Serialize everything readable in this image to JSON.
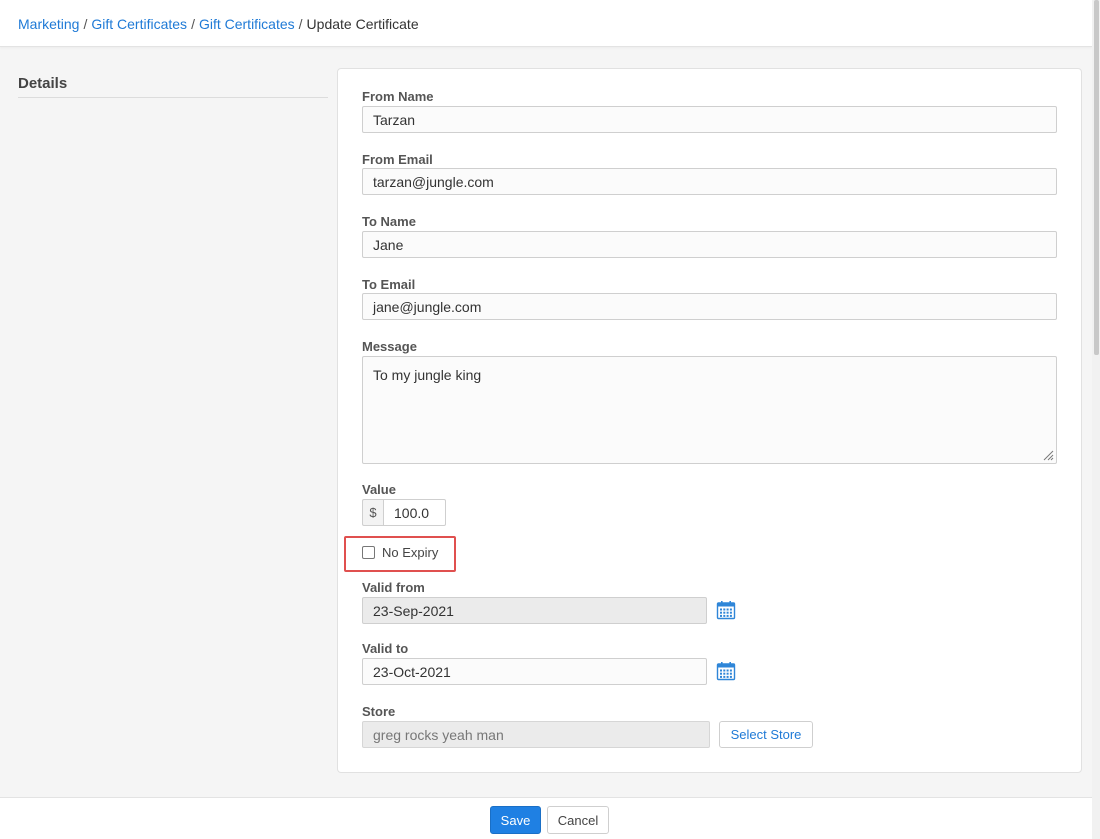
{
  "breadcrumb": {
    "items": [
      "Marketing",
      "Gift Certificates",
      "Gift Certificates"
    ],
    "separator": "/",
    "current": "Update Certificate"
  },
  "section": {
    "title": "Details"
  },
  "form": {
    "from_name": {
      "label": "From Name",
      "value": "Tarzan"
    },
    "from_email": {
      "label": "From Email",
      "value": "tarzan@jungle.com"
    },
    "to_name": {
      "label": "To Name",
      "value": "Jane"
    },
    "to_email": {
      "label": "To Email",
      "value": "jane@jungle.com"
    },
    "message": {
      "label": "Message",
      "value": "To my jungle king"
    },
    "value": {
      "label": "Value",
      "currency": "$",
      "amount": "100.0"
    },
    "no_expiry": {
      "label": "No Expiry",
      "checked": false
    },
    "valid_from": {
      "label": "Valid from",
      "value": "23-Sep-2021",
      "disabled": true
    },
    "valid_to": {
      "label": "Valid to",
      "value": "23-Oct-2021",
      "disabled": false
    },
    "store": {
      "label": "Store",
      "value": "greg rocks yeah man",
      "button": "Select Store"
    }
  },
  "footer": {
    "save_label": "Save",
    "cancel_label": "Cancel"
  },
  "colors": {
    "link": "#1f7ad6",
    "primary_button": "#1f80e3",
    "highlight": "#e0504f",
    "calendar_icon": "#2f86d8"
  },
  "icons": [
    "calendar-icon",
    "resize-grip-icon"
  ]
}
